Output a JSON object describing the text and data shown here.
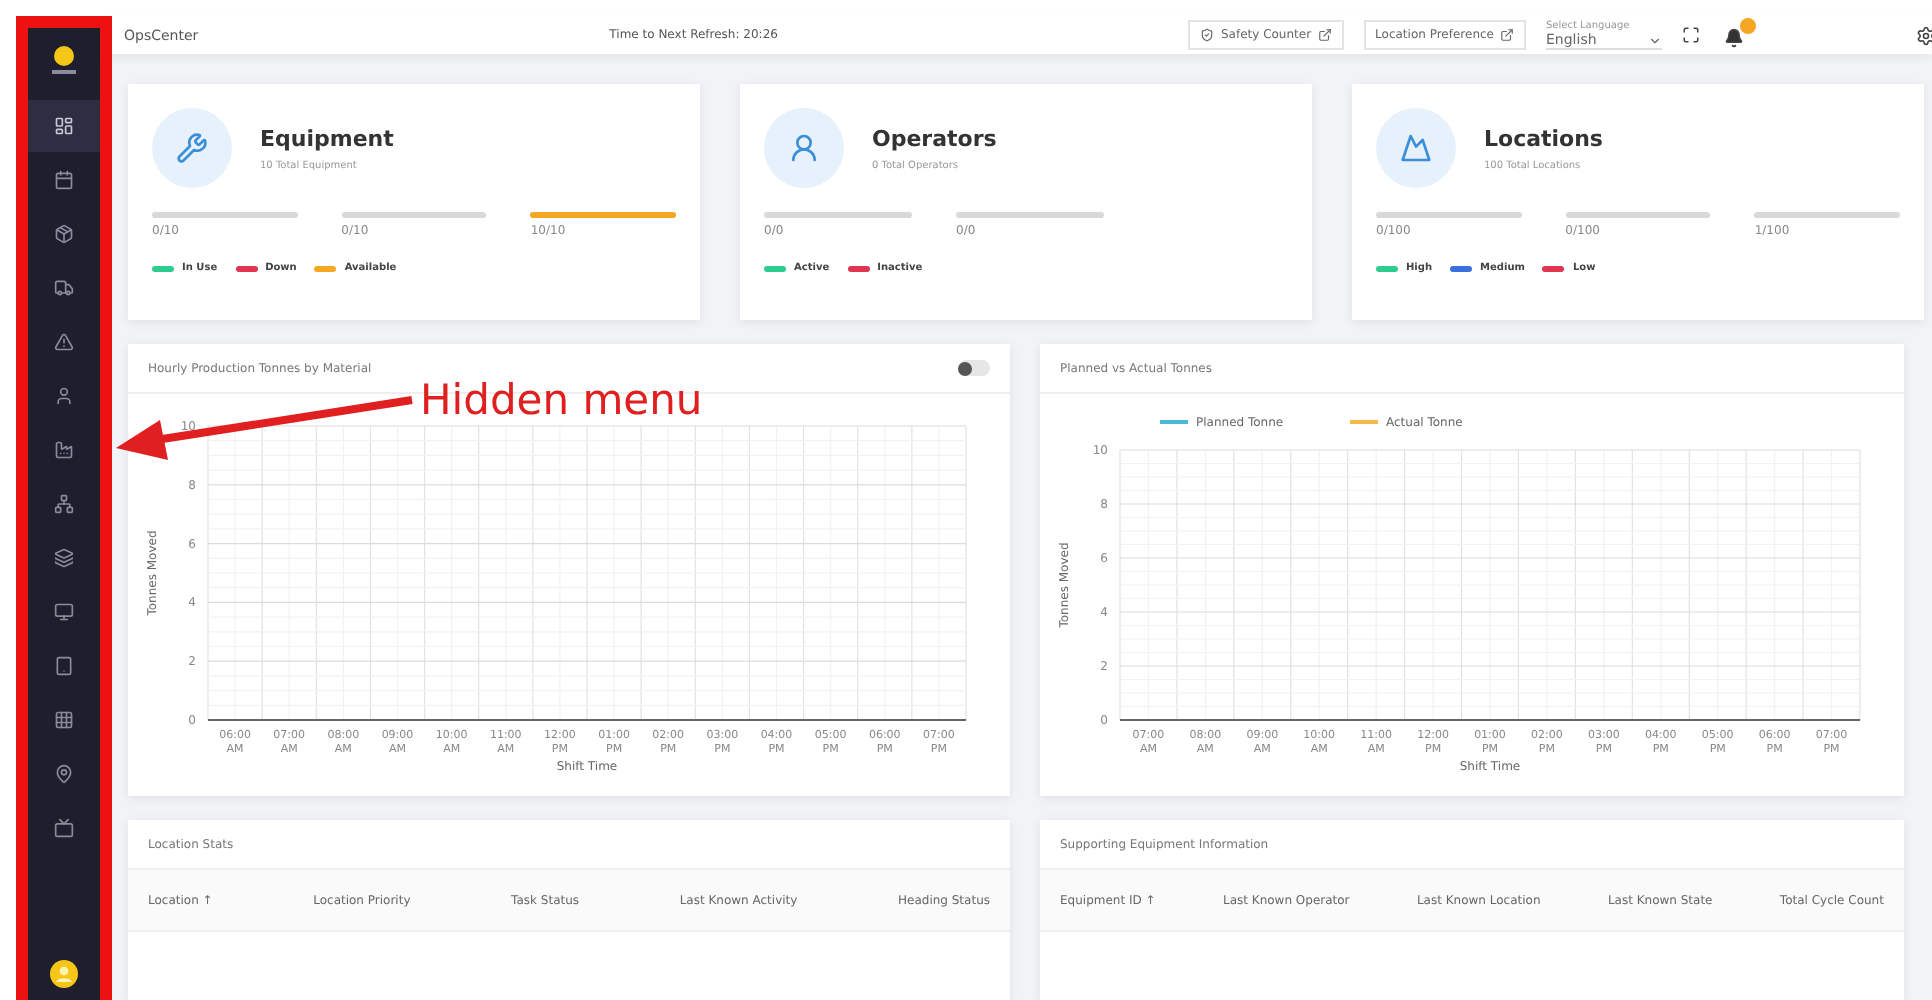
{
  "sidebar": {
    "items": [
      {
        "selected": true
      },
      {
        "selected": false
      },
      {
        "selected": false
      },
      {
        "selected": false
      },
      {
        "selected": false
      },
      {
        "selected": false
      },
      {
        "selected": false
      },
      {
        "selected": false
      },
      {
        "selected": false
      },
      {
        "selected": false
      },
      {
        "selected": false
      },
      {
        "selected": false
      },
      {
        "selected": false
      },
      {
        "selected": false
      }
    ]
  },
  "topbar": {
    "title": "OpsCenter",
    "refresh": "Time to Next Refresh: 20:26",
    "links": [
      "Safety Counter",
      "Location Preference"
    ],
    "language": {
      "label": "Select Language",
      "value": "English"
    },
    "notification": true
  },
  "cards": [
    {
      "title": "Equipment",
      "subtitle": "10 Total Equipment",
      "bars": [
        {
          "reading": "0/10",
          "level": 0
        },
        {
          "reading": "0/10",
          "level": 0
        },
        {
          "reading": "10/10",
          "level": 1
        }
      ],
      "legend": [
        {
          "label": "In Use",
          "color": "#2ecc8f"
        },
        {
          "label": "Down",
          "color": "#e0344f"
        },
        {
          "label": "Available",
          "color": "#f5a623"
        }
      ]
    },
    {
      "title": "Operators",
      "subtitle": "0 Total Operators",
      "bars": [
        {
          "reading": "0/0",
          "level": 0
        },
        {
          "reading": "0/0",
          "level": 0
        }
      ],
      "legend": [
        {
          "label": "Active",
          "color": "#2ecc8f"
        },
        {
          "label": "Inactive",
          "color": "#e0344f"
        }
      ]
    },
    {
      "title": "Locations",
      "subtitle": "100 Total Locations",
      "bars": [
        {
          "reading": "0/100",
          "level": 0
        },
        {
          "reading": "0/100",
          "level": 0
        },
        {
          "reading": "1/100",
          "level": 0
        }
      ],
      "legend": [
        {
          "label": "High",
          "color": "#2ecc8f"
        },
        {
          "label": "Medium",
          "color": "#3b6fe0"
        },
        {
          "label": "Low",
          "color": "#e0344f"
        }
      ]
    }
  ],
  "charts": [
    {
      "title": "Hourly Production Tonnes by Material",
      "toggle": false,
      "chart_data": {
        "type": "line",
        "grid": true,
        "xlabel": "Shift Time",
        "ylabel": "Tonnes Moved",
        "x": [
          "06:00 AM",
          "07:00 AM",
          "08:00 AM",
          "09:00 AM",
          "10:00 AM",
          "11:00 AM",
          "12:00 PM",
          "01:00 PM",
          "02:00 PM",
          "03:00 PM",
          "04:00 PM",
          "05:00 PM",
          "06:00 PM",
          "07:00 PM"
        ],
        "ylim": [
          0,
          10
        ],
        "yticks": [
          0,
          2,
          4,
          6,
          8,
          10
        ]
      }
    },
    {
      "title": "Planned vs Actual Tonnes",
      "chart_data": {
        "type": "line",
        "grid": true,
        "xlabel": "Shift Time",
        "ylabel": "Tonnes Moved",
        "x": [
          "07:00 AM",
          "08:00 AM",
          "09:00 AM",
          "10:00 AM",
          "11:00 AM",
          "12:00 PM",
          "01:00 PM",
          "02:00 PM",
          "03:00 PM",
          "04:00 PM",
          "05:00 PM",
          "06:00 PM",
          "07:00 PM"
        ],
        "ylim": [
          0,
          10
        ],
        "yticks": [
          0,
          2,
          4,
          6,
          8,
          10
        ],
        "series": [
          {
            "name": "Planned Tonne",
            "color": "#4bb8d6",
            "values": [
              null,
              null,
              null,
              null,
              null,
              null,
              null,
              null,
              null,
              null,
              null,
              null,
              null
            ]
          },
          {
            "name": "Actual Tonne",
            "color": "#f5b84a",
            "values": [
              null,
              null,
              null,
              null,
              null,
              null,
              null,
              null,
              null,
              null,
              null,
              null,
              null
            ]
          }
        ]
      }
    }
  ],
  "tables": [
    {
      "title": "Location Stats",
      "columns": [
        "Location ↑",
        "Location Priority",
        "Task Status",
        "Last Known Activity",
        "Heading Status"
      ]
    },
    {
      "title": "Supporting Equipment Information",
      "columns": [
        "Equipment ID ↑",
        "Last Known Operator",
        "Last Known Location",
        "Last Known State",
        "Total Cycle Count"
      ]
    }
  ],
  "annotation": {
    "label": "Hidden menu"
  }
}
